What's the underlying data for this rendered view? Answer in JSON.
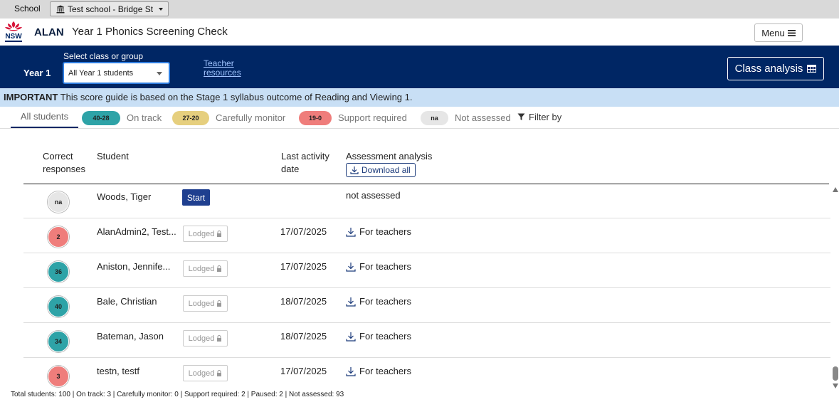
{
  "school_bar": {
    "label": "School",
    "selected_school": "Test school - Bridge St"
  },
  "header": {
    "brand": "ALAN",
    "title": "Year 1 Phonics Screening Check",
    "menu_label": "Menu"
  },
  "nav": {
    "year_label": "Year 1",
    "select_label": "Select class or group",
    "selected_group": "All Year 1 students",
    "teacher_resources_line1": "Teacher",
    "teacher_resources_line2": "resources",
    "class_analysis_label": "Class analysis"
  },
  "banner": {
    "strong": "IMPORTANT",
    "text": " This score guide is based on the Stage 1 syllabus outcome of Reading and Viewing 1."
  },
  "filters": {
    "all_students": "All students",
    "on_track_range": "40-28",
    "on_track_label": "On track",
    "monitor_range": "27-20",
    "monitor_label": "Carefully monitor",
    "support_range": "19-0",
    "support_label": "Support required",
    "na_badge": "na",
    "na_label": "Not assessed",
    "filter_label": "Filter by",
    "colors": {
      "on_track": "#2ea3a7",
      "monitor": "#e6cf7e",
      "support": "#ef7d7b",
      "na": "#e6e6e6"
    }
  },
  "table": {
    "col_correct_1": "Correct",
    "col_correct_2": "responses",
    "col_student": "Student",
    "col_date_1": "Last activity",
    "col_date_2": "date",
    "col_analysis": "Assessment analysis",
    "download_all": "Download all",
    "rows": [
      {
        "score": "na",
        "status": "na",
        "name": "Woods, Tiger",
        "action": "Start",
        "date": "",
        "analysis": "not assessed"
      },
      {
        "score": "2",
        "status": "support",
        "name": "AlanAdmin2, Test...",
        "action": "Lodged",
        "date": "17/07/2025",
        "analysis": "For teachers"
      },
      {
        "score": "36",
        "status": "on_track",
        "name": "Aniston, Jennife...",
        "action": "Lodged",
        "date": "17/07/2025",
        "analysis": "For teachers"
      },
      {
        "score": "40",
        "status": "on_track",
        "name": "Bale, Christian",
        "action": "Lodged",
        "date": "18/07/2025",
        "analysis": "For teachers"
      },
      {
        "score": "34",
        "status": "on_track",
        "name": "Bateman, Jason",
        "action": "Lodged",
        "date": "18/07/2025",
        "analysis": "For teachers"
      },
      {
        "score": "3",
        "status": "support",
        "name": "testn, testf",
        "action": "Lodged",
        "date": "17/07/2025",
        "analysis": "For teachers"
      }
    ]
  },
  "footer": {
    "summary": "Total students: 100 | On track: 3 | Carefully monitor: 0 | Support required: 2 | Paused: 2 | Not assessed: 93"
  }
}
